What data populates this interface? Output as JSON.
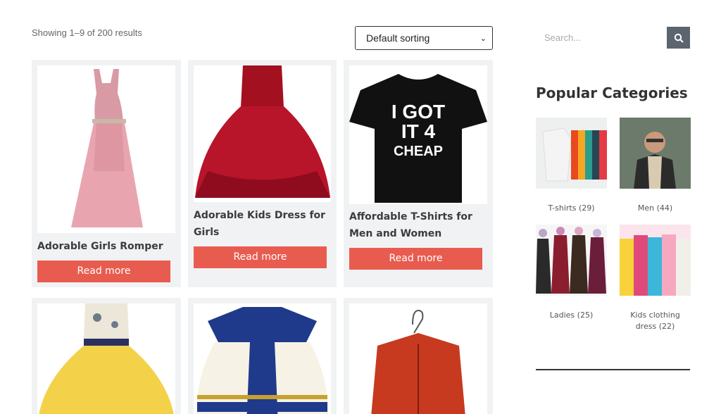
{
  "shop": {
    "result_count": "Showing 1–9 of 200 results",
    "sorting": {
      "selected": "Default sorting"
    }
  },
  "products": [
    {
      "title": "Adorable Girls Romper",
      "button": "Read more",
      "image": "pink-romper"
    },
    {
      "title": "Adorable Kids Dress for Girls",
      "button": "Read more",
      "image": "red-dress"
    },
    {
      "title": "Affordable T-Shirts for Men and Women",
      "button": "Read more",
      "image": "black-tshirt",
      "image_text": [
        "I GOT",
        "IT 4",
        "CHEAP"
      ]
    },
    {
      "image": "yellow-dress"
    },
    {
      "image": "blue-white-dress"
    },
    {
      "image": "red-hoodie"
    }
  ],
  "sidebar": {
    "search": {
      "placeholder": "Search..."
    },
    "popular_title": "Popular Categories",
    "categories": [
      {
        "name": "T-shirts",
        "count": "(29)"
      },
      {
        "name": "Men",
        "count": "(44)"
      },
      {
        "name": "Ladies",
        "count": "(25)"
      },
      {
        "name": "Kids clothing dress",
        "count": "(22)"
      }
    ]
  },
  "colors": {
    "accent": "#e85c4f",
    "card_bg": "#f1f2f4",
    "search_btn": "#5c6470"
  }
}
